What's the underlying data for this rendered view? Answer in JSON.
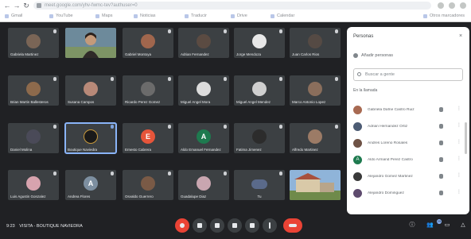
{
  "browser": {
    "url": "meet.google.com/yhv-fwmc-tev?authuser=0",
    "bookmarks": [
      "Gmail",
      "YouTube",
      "Maps",
      "Noticias",
      "Traducir",
      "Drive",
      "Calendar",
      "Otros marcadores"
    ]
  },
  "tiles": [
    {
      "name": "Gabriela Martinez",
      "initial": ""
    },
    {
      "name": "",
      "initial": ""
    },
    {
      "name": "Gabriel Montoya",
      "initial": ""
    },
    {
      "name": "Adrian Fernandez",
      "initial": ""
    },
    {
      "name": "Jorge Mendoza",
      "initial": ""
    },
    {
      "name": "Juan Carlos Rios",
      "initial": ""
    },
    {
      "name": "Brian Martin Ballesteros",
      "initial": ""
    },
    {
      "name": "Susana Campos",
      "initial": ""
    },
    {
      "name": "Ricardo Perez Gomez",
      "initial": ""
    },
    {
      "name": "Miguel Angel Mora",
      "initial": ""
    },
    {
      "name": "Miguel Angel Mendez",
      "initial": ""
    },
    {
      "name": "Marco Antonio Lopez",
      "initial": ""
    },
    {
      "name": "Daniel Molina",
      "initial": ""
    },
    {
      "name": "Boutique Naviedra",
      "initial": ""
    },
    {
      "name": "Ernesto Cabrera",
      "initial": "E"
    },
    {
      "name": "Aldo Emanuel Fernandez",
      "initial": "A"
    },
    {
      "name": "Fatima Jimenez",
      "initial": ""
    },
    {
      "name": "Alfredo Martinez",
      "initial": ""
    },
    {
      "name": "Luis Agustin Gonzalez",
      "initial": ""
    },
    {
      "name": "Andrea Flores",
      "initial": "A"
    },
    {
      "name": "Osvaldo Guerrero",
      "initial": ""
    },
    {
      "name": "Guadalupe Diaz",
      "initial": ""
    },
    {
      "name": "Tu",
      "initial": ""
    },
    {
      "name": "",
      "initial": ""
    }
  ],
  "panel": {
    "title": "Personas",
    "add_label": "Añadir personas",
    "search_placeholder": "Buscar a gente",
    "section_label": "En la llamada",
    "close_icon": "×",
    "participants": [
      {
        "name": "Gabriela Dafne Castro Ruiz",
        "initial": ""
      },
      {
        "name": "Adrian Hernandez Ortiz",
        "initial": ""
      },
      {
        "name": "Andres Loreno Rosales",
        "initial": ""
      },
      {
        "name": "Aldo Armand Perez Castro",
        "initial": "A"
      },
      {
        "name": "Alejandro Gomez Martinez",
        "initial": ""
      },
      {
        "name": "Alejandro Dominguez",
        "initial": ""
      }
    ]
  },
  "bottom": {
    "time": "9:23",
    "meeting_name": "VISITA - BOUTIQUE NAVIEDRA",
    "participant_count": "25",
    "colors": {
      "end_call": "#ea4335",
      "mic_off": "#ea4335",
      "accent": "#8ab4f8"
    }
  }
}
